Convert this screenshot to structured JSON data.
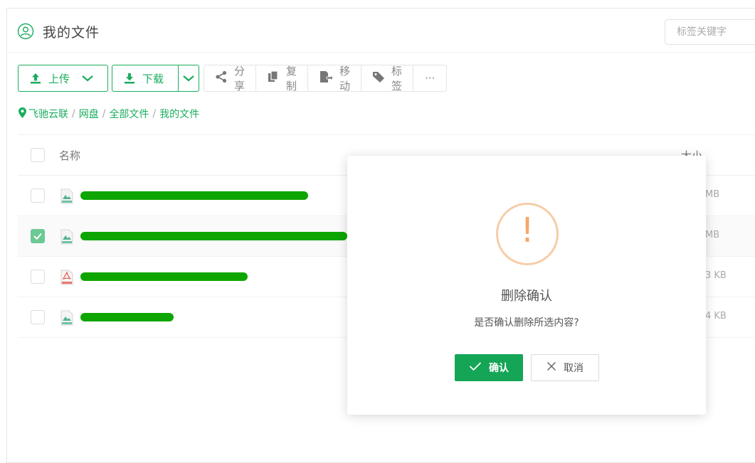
{
  "header": {
    "title": "我的文件",
    "icon": "user-circle-icon",
    "tag_search_placeholder": "标签关键字"
  },
  "toolbar": {
    "upload_label": "上传",
    "download_label": "下载",
    "share_label": "分享",
    "copy_label": "复制",
    "move_label": "移动",
    "tag_label": "标签",
    "more_label": "···"
  },
  "breadcrumb": {
    "items": [
      "飞驰云联",
      "网盘",
      "全部文件",
      "我的文件"
    ],
    "separator": "/"
  },
  "table": {
    "columns": {
      "name": "名称",
      "size": "大小"
    },
    "rows": [
      {
        "type": "jpg",
        "name": "",
        "size": "MB",
        "checked": false
      },
      {
        "type": "jpg",
        "name": "",
        "size": "MB",
        "checked": true
      },
      {
        "type": "pdf",
        "name": "",
        "size": "3 KB",
        "checked": false
      },
      {
        "type": "jpg",
        "name": "",
        "size": "4 KB",
        "checked": false
      }
    ]
  },
  "dialog": {
    "icon": "warning-icon",
    "mark": "!",
    "title": "删除确认",
    "message": "是否确认删除所选内容?",
    "confirm_label": "确认",
    "cancel_label": "取消"
  },
  "colors": {
    "accent": "#1aad5f",
    "confirm": "#14a556",
    "warning": "#f5a76a"
  }
}
